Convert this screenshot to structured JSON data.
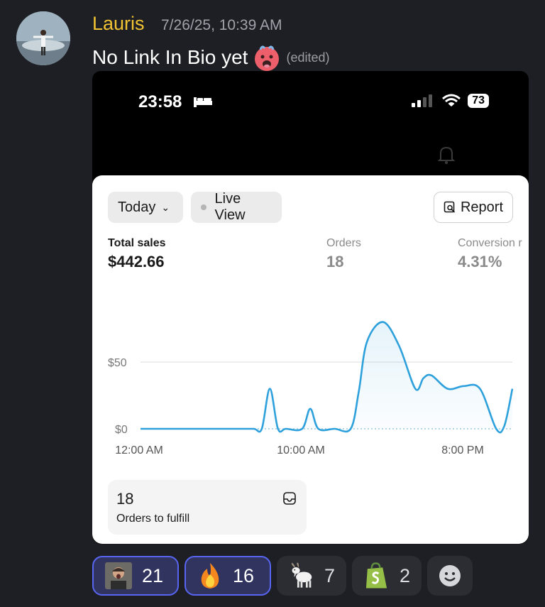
{
  "message": {
    "author": "Lauris",
    "author_color": "#f1c232",
    "timestamp": "7/26/25, 10:39 AM",
    "text": "No Link In Bio yet",
    "emoji": "hot-face-emoji",
    "edited_label": "(edited)"
  },
  "phone": {
    "status_time": "23:58",
    "battery": "73"
  },
  "dashboard": {
    "period_label": "Today",
    "live_view_label": "Live View",
    "report_label": "Report",
    "metrics": [
      {
        "label": "Total sales",
        "value": "$442.66"
      },
      {
        "label": "Orders",
        "value": "18"
      },
      {
        "label": "Conversion r",
        "value": "4.31%"
      }
    ],
    "fulfill_count": "18",
    "fulfill_label": "Orders to fulfill"
  },
  "chart_data": {
    "type": "area",
    "y_ticks": [
      "$50",
      "$0"
    ],
    "x_ticks": [
      "12:00 AM",
      "10:00 AM",
      "8:00 PM"
    ],
    "ylim": [
      0,
      100
    ],
    "line_color": "#2ea1dc",
    "x_hours": [
      0,
      1,
      2,
      3,
      4,
      5,
      6,
      7,
      7.5,
      8,
      8.5,
      9,
      10,
      10.5,
      11,
      12,
      13,
      13.5,
      14,
      15,
      16,
      17,
      17.5,
      18,
      19,
      20,
      21,
      22,
      22.5,
      23
    ],
    "values": [
      0,
      0,
      0,
      0,
      0,
      0,
      0,
      0,
      0,
      30,
      0,
      0,
      0,
      15,
      0,
      0,
      0,
      28,
      65,
      80,
      62,
      30,
      38,
      40,
      30,
      32,
      30,
      0,
      2,
      30
    ]
  },
  "reactions": [
    {
      "emoji": "person-photo-emoji",
      "count": "21",
      "reacted": true
    },
    {
      "emoji": "fire-emoji",
      "count": "16",
      "reacted": true
    },
    {
      "emoji": "goat-emoji",
      "count": "7",
      "reacted": false
    },
    {
      "emoji": "shopify-emoji",
      "count": "2",
      "reacted": false
    }
  ]
}
